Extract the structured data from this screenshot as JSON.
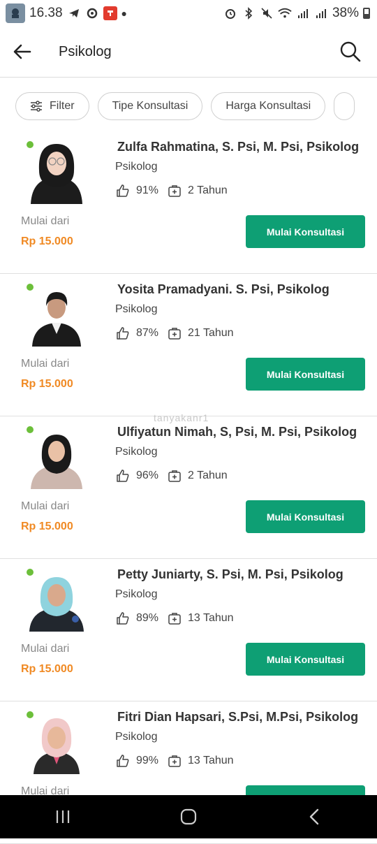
{
  "status_bar": {
    "time": "16.38",
    "battery": "38%"
  },
  "header": {
    "title": "Psikolog"
  },
  "filters": [
    {
      "label": "Filter"
    },
    {
      "label": "Tipe Konsultasi"
    },
    {
      "label": "Harga Konsultasi"
    }
  ],
  "watermark": "tanyakanr1",
  "cards": [
    {
      "name": "Zulfa Rahmatina, S. Psi, M. Psi, Psikolog",
      "role": "Psikolog",
      "rating": "91%",
      "experience": "2 Tahun",
      "price_label": "Mulai dari",
      "price": "Rp 15.000",
      "cta": "Mulai Konsultasi"
    },
    {
      "name": "Yosita Pramadyani. S. Psi, Psikolog",
      "role": "Psikolog",
      "rating": "87%",
      "experience": "21 Tahun",
      "price_label": "Mulai dari",
      "price": "Rp 15.000",
      "cta": "Mulai Konsultasi"
    },
    {
      "name": "Ulfiyatun Nimah, S, Psi, M. Psi, Psikolog",
      "role": "Psikolog",
      "rating": "96%",
      "experience": "2 Tahun",
      "price_label": "Mulai dari",
      "price": "Rp 15.000",
      "cta": "Mulai Konsultasi"
    },
    {
      "name": "Petty Juniarty,  S. Psi,  M. Psi,  Psikolog",
      "role": "Psikolog",
      "rating": "89%",
      "experience": "13 Tahun",
      "price_label": "Mulai dari",
      "price": "Rp 15.000",
      "cta": "Mulai Konsultasi"
    },
    {
      "name": "Fitri Dian Hapsari, S.Psi, M.Psi, Psikolog",
      "role": "Psikolog",
      "rating": "99%",
      "experience": "13 Tahun",
      "price_label": "Mulai dari",
      "price": "",
      "cta": ""
    }
  ],
  "colors": {
    "accent": "#0e9f74",
    "price": "#f08a24",
    "online": "#6cbf3a"
  }
}
